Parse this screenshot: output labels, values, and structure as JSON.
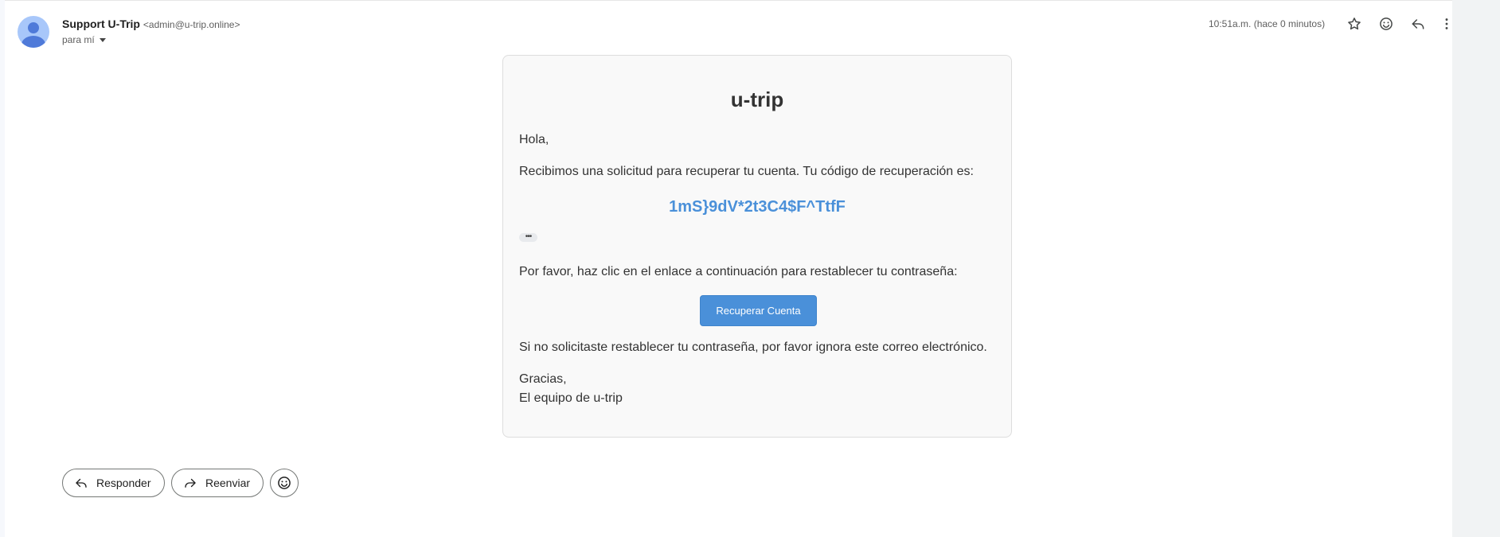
{
  "header": {
    "sender_name": "Support U-Trip",
    "sender_email": "<admin@u-trip.online>",
    "to_label": "para mí",
    "timestamp": "10:51a.m. (hace 0 minutos)",
    "icons": [
      "star-icon",
      "emoji-icon",
      "reply-icon",
      "more-vert-icon"
    ]
  },
  "email": {
    "title": "u-trip",
    "greeting": "Hola,",
    "intro": "Recibimos una solicitud para recuperar tu cuenta. Tu código de recuperación es:",
    "code": "1mS}9dV*2t3C4$F^TtfF",
    "collapsed_indicator": "•••",
    "instruction": "Por favor, haz clic en el enlace a continuación para restablecer tu contraseña:",
    "button_label": "Recuperar Cuenta",
    "ignore_note": "Si no solicitaste restablecer tu contraseña, por favor ignora este correo electrónico.",
    "thanks": "Gracias,",
    "signature": "El equipo de u-trip"
  },
  "actions": {
    "reply_label": "Responder",
    "forward_label": "Reenviar"
  },
  "colors": {
    "accent": "#4a90d9",
    "card_bg": "#f9f9f9",
    "avatar_bg": "#a8c7fa"
  }
}
